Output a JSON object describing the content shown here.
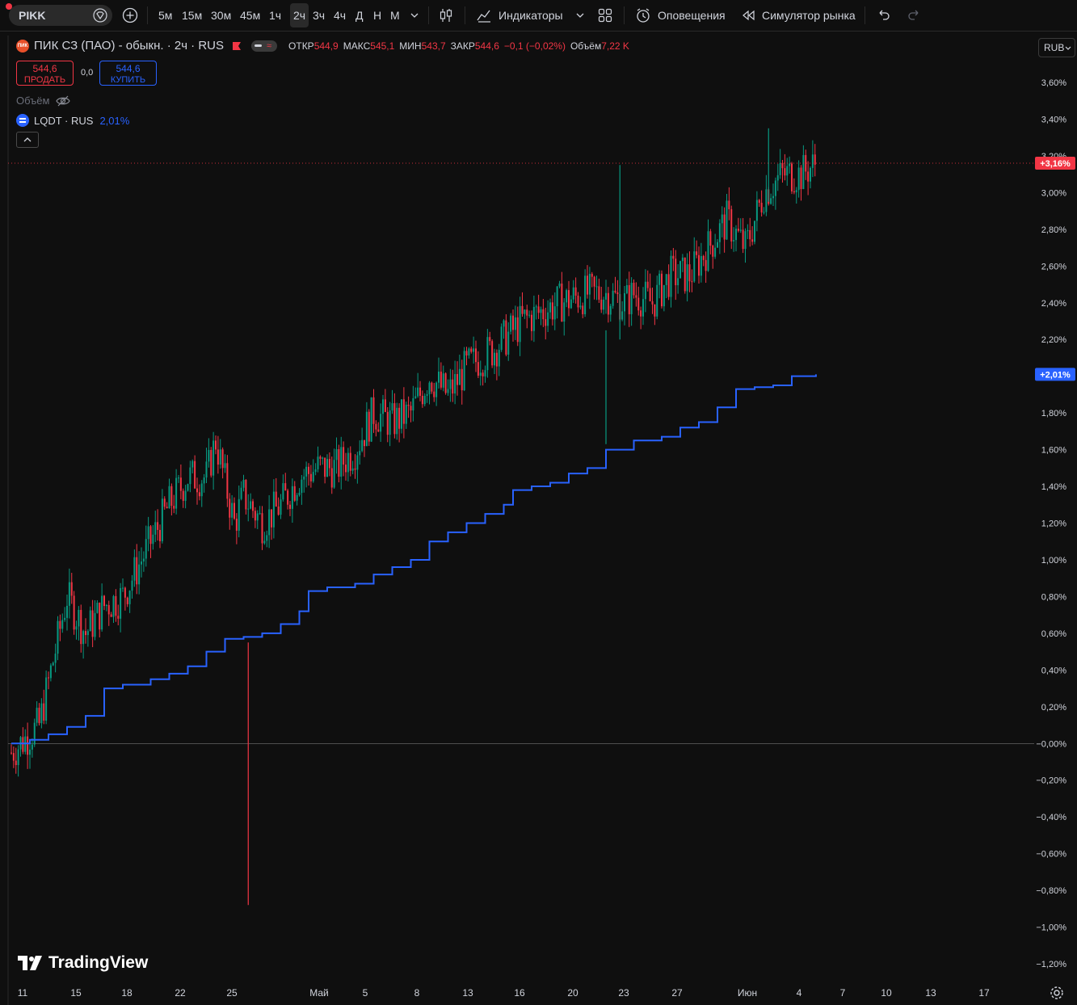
{
  "toolbar": {
    "symbol": "PIKK",
    "intervals": [
      "5м",
      "15м",
      "30м",
      "45м",
      "1ч",
      "2ч",
      "3ч",
      "4ч",
      "Д",
      "Н",
      "М"
    ],
    "active_interval": "2ч",
    "indicators_label": "Индикаторы",
    "alerts_label": "Оповещения",
    "replay_label": "Симулятор рынка"
  },
  "legend": {
    "logo_text": "ПИК",
    "title": "ПИК СЗ (ПАО) - обыкн. · 2ч · RUS",
    "open_label": "ОТКР",
    "open": "544,9",
    "high_label": "МАКС",
    "high": "545,1",
    "low_label": "МИН",
    "low": "543,7",
    "close_label": "ЗАКР",
    "close": "544,6",
    "change": "−0,1 (−0,02%)",
    "volume_label": "Объём",
    "volume": "7,22 K"
  },
  "trade": {
    "sell_price": "544,6",
    "sell_label": "ПРОДАТЬ",
    "spread": "0,0",
    "buy_price": "544,6",
    "buy_label": "КУПИТЬ"
  },
  "volume_study": {
    "label": "Объём"
  },
  "compare": {
    "symbol": "LQDT · RUS",
    "value": "2,01%"
  },
  "currency": "RUB",
  "brand": "TradingView",
  "colors": {
    "up": "#089981",
    "down": "#f23645",
    "compare": "#2962ff",
    "bg": "#0f0f0f",
    "axis_text": "#d1d4dc"
  },
  "chart_data": {
    "type": "line",
    "scale": "percent",
    "ylim": [
      -1.25,
      3.7
    ],
    "y_ticks": [
      "3,60%",
      "3,40%",
      "3,20%",
      "3,00%",
      "2,80%",
      "2,60%",
      "2,40%",
      "2,20%",
      "2,00%",
      "1,80%",
      "1,60%",
      "1,40%",
      "1,20%",
      "1,00%",
      "0,80%",
      "0,60%",
      "0,40%",
      "0,20%",
      "−0,00%",
      "−0,20%",
      "−0,40%",
      "−0,60%",
      "−0,80%",
      "−1,00%",
      "−1,20%"
    ],
    "x_ticks": [
      "11",
      "15",
      "18",
      "22",
      "25",
      "Май",
      "5",
      "8",
      "13",
      "16",
      "20",
      "23",
      "27",
      "Июн",
      "4",
      "7",
      "10",
      "13",
      "17"
    ],
    "series": [
      {
        "name": "ПИК СЗ (ПАО) - обыкн.",
        "style": "candles",
        "last_label": "+3,16%",
        "path": [
          [
            0,
            -0.05
          ],
          [
            3,
            0.1
          ],
          [
            6,
            0.8
          ],
          [
            8,
            0.6
          ],
          [
            10,
            0.75
          ],
          [
            12,
            0.8
          ],
          [
            14,
            1.0
          ],
          [
            17,
            1.3
          ],
          [
            19,
            1.45
          ],
          [
            21,
            1.45
          ],
          [
            22,
            1.65
          ],
          [
            24,
            1.2
          ],
          [
            25,
            1.35
          ],
          [
            27,
            1.2
          ],
          [
            29,
            1.3
          ],
          [
            31,
            1.45
          ],
          [
            33,
            1.5
          ],
          [
            35,
            1.5
          ],
          [
            37,
            1.6
          ],
          [
            39,
            1.8
          ],
          [
            41,
            1.75
          ],
          [
            43,
            1.8
          ],
          [
            45,
            2.0
          ],
          [
            47,
            1.9
          ],
          [
            49,
            2.05
          ],
          [
            52,
            2.15
          ],
          [
            55,
            2.3
          ],
          [
            57,
            2.35
          ],
          [
            59,
            2.4
          ],
          [
            62,
            2.45
          ],
          [
            64,
            2.45
          ],
          [
            66,
            2.4
          ],
          [
            67,
            2.45
          ],
          [
            69,
            2.4
          ],
          [
            71,
            2.55
          ],
          [
            73,
            2.55
          ],
          [
            75,
            2.7
          ],
          [
            77,
            2.85
          ],
          [
            79,
            2.7
          ],
          [
            81,
            3.0
          ],
          [
            83,
            3.1
          ],
          [
            85,
            3.1
          ],
          [
            86.6,
            3.16
          ]
        ]
      },
      {
        "name": "LQDT · RUS",
        "style": "step-line",
        "last_label": "+2,01%",
        "path": [
          [
            0,
            0.0
          ],
          [
            2,
            0.02
          ],
          [
            4,
            0.05
          ],
          [
            6,
            0.09
          ],
          [
            8,
            0.15
          ],
          [
            10,
            0.3
          ],
          [
            12,
            0.32
          ],
          [
            15,
            0.35
          ],
          [
            17,
            0.38
          ],
          [
            19,
            0.42
          ],
          [
            21,
            0.5
          ],
          [
            23,
            0.57
          ],
          [
            25,
            0.58
          ],
          [
            27,
            0.6
          ],
          [
            29,
            0.65
          ],
          [
            31,
            0.72
          ],
          [
            32,
            0.83
          ],
          [
            34,
            0.85
          ],
          [
            37,
            0.87
          ],
          [
            39,
            0.92
          ],
          [
            41,
            0.96
          ],
          [
            43,
            1.0
          ],
          [
            45,
            1.1
          ],
          [
            47,
            1.15
          ],
          [
            49,
            1.2
          ],
          [
            51,
            1.25
          ],
          [
            53,
            1.3
          ],
          [
            54,
            1.38
          ],
          [
            56,
            1.4
          ],
          [
            58,
            1.42
          ],
          [
            60,
            1.47
          ],
          [
            62,
            1.5
          ],
          [
            64,
            1.6
          ],
          [
            67,
            1.65
          ],
          [
            70,
            1.67
          ],
          [
            72,
            1.72
          ],
          [
            74,
            1.75
          ],
          [
            76,
            1.83
          ],
          [
            78,
            1.93
          ],
          [
            80,
            1.94
          ],
          [
            82,
            1.95
          ],
          [
            84,
            2.0
          ],
          [
            86.6,
            2.01
          ]
        ]
      }
    ],
    "annotations": [
      {
        "bar": 25.5,
        "low": -0.88,
        "high": 0.55,
        "direction": "down"
      },
      {
        "bar": 64,
        "low": 1.63,
        "high": 2.25,
        "direction": "up"
      },
      {
        "bar": 65.5,
        "low": 2.2,
        "high": 3.15,
        "direction": "up"
      },
      {
        "bar": 81.5,
        "low": 2.95,
        "high": 3.35,
        "direction": "up"
      }
    ],
    "grid": false,
    "legend_position": "top-left"
  }
}
